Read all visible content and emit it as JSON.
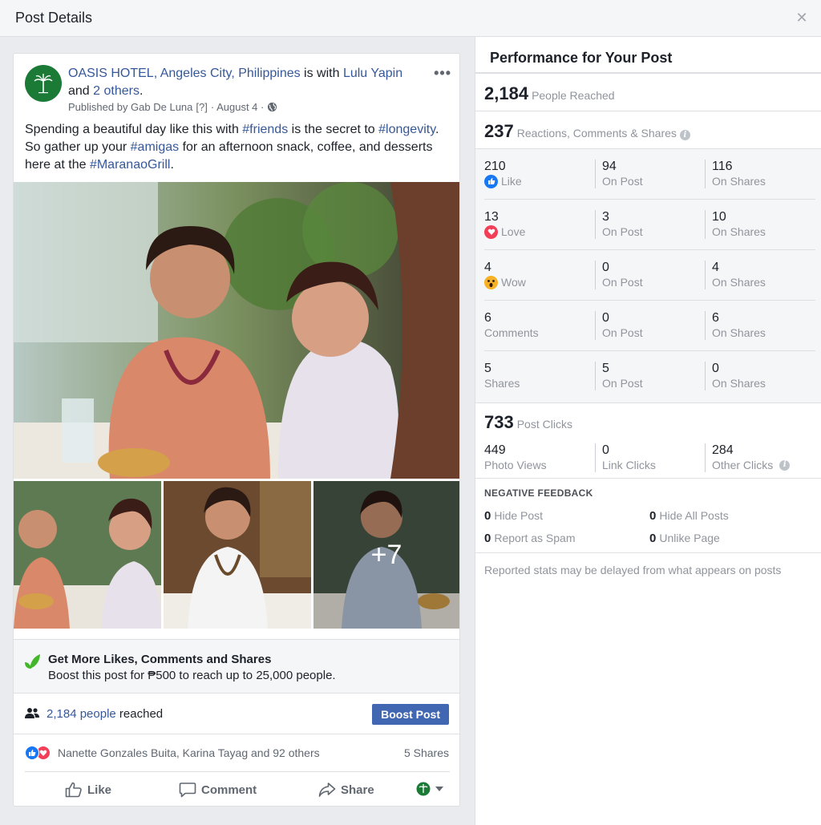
{
  "dialog": {
    "title": "Post Details",
    "close_glyph": "✕"
  },
  "post": {
    "page_name": "OASIS HOTEL, Angeles City, Philippines",
    "with_text": " is with ",
    "tagged_person": "Lulu Yapin",
    "and_text": "and ",
    "others_link": "2 others",
    "period": ".",
    "published_by": "Published by Gab De Luna",
    "help_marker": "[?]",
    "date": "· August 4 ·",
    "text_parts": {
      "p1": "Spending a beautiful day like this with ",
      "tag1": "#friends",
      "p2": " is the secret to ",
      "tag2": "#longevity",
      "p3": ". So gather up your ",
      "tag3": "#amigas",
      "p4": " for an afternoon snack, coffee, and desserts here at the ",
      "tag4": "#MaranaoGrill",
      "p5": "."
    },
    "more_photos": "+7",
    "more_glyph": "•••"
  },
  "boost": {
    "title": "Get More Likes, Comments and Shares",
    "subtitle": "Boost this post for ₱500 to reach up to 25,000 people."
  },
  "reach": {
    "people_link": "2,184 people",
    "suffix": " reached",
    "boost_button": "Boost Post"
  },
  "reactions": {
    "names": "Nanette Gonzales Buita, Karina Tayag and 92 others",
    "shares": "5 Shares"
  },
  "actions": {
    "like": "Like",
    "comment": "Comment",
    "share": "Share"
  },
  "panel": {
    "title": "Performance for Your Post",
    "reached": {
      "value": "2,184",
      "label": "People Reached"
    },
    "engagement": {
      "value": "237",
      "label": "Reactions, Comments & Shares"
    },
    "rows": [
      {
        "total": "210",
        "label": "Like",
        "on_post": "94",
        "on_post_label": "On Post",
        "on_shares": "116",
        "on_shares_label": "On Shares"
      },
      {
        "total": "13",
        "label": "Love",
        "on_post": "3",
        "on_post_label": "On Post",
        "on_shares": "10",
        "on_shares_label": "On Shares"
      },
      {
        "total": "4",
        "label": "Wow",
        "on_post": "0",
        "on_post_label": "On Post",
        "on_shares": "4",
        "on_shares_label": "On Shares"
      },
      {
        "total": "6",
        "label": "Comments",
        "on_post": "0",
        "on_post_label": "On Post",
        "on_shares": "6",
        "on_shares_label": "On Shares"
      },
      {
        "total": "5",
        "label": "Shares",
        "on_post": "5",
        "on_post_label": "On Post",
        "on_shares": "0",
        "on_shares_label": "On Shares"
      }
    ],
    "clicks": {
      "value": "733",
      "label": "Post Clicks",
      "photo_views": "449",
      "photo_views_label": "Photo Views",
      "link_clicks": "0",
      "link_clicks_label": "Link Clicks",
      "other_clicks": "284",
      "other_clicks_label": "Other Clicks"
    },
    "negative": {
      "title": "NEGATIVE FEEDBACK",
      "hide_post": {
        "value": "0",
        "label": "Hide Post"
      },
      "hide_all": {
        "value": "0",
        "label": "Hide All Posts"
      },
      "spam": {
        "value": "0",
        "label": "Report as Spam"
      },
      "unlike": {
        "value": "0",
        "label": "Unlike Page"
      }
    },
    "footnote": "Reported stats may be delayed from what appears on posts",
    "info_glyph": "i"
  },
  "colors": {
    "link": "#365899",
    "brand_blue": "#4267b2",
    "love": "#f33e58",
    "wow": "#f7b125",
    "hotel_green": "#1a7a36"
  },
  "icons": [
    "close-icon",
    "more-icon",
    "globe-icon",
    "leaf-icon",
    "people-icon",
    "like-reaction-icon",
    "love-reaction-icon",
    "wow-reaction-icon",
    "thumbs-up-icon",
    "comment-icon",
    "share-icon",
    "audience-icon",
    "dropdown-icon",
    "info-icon"
  ]
}
